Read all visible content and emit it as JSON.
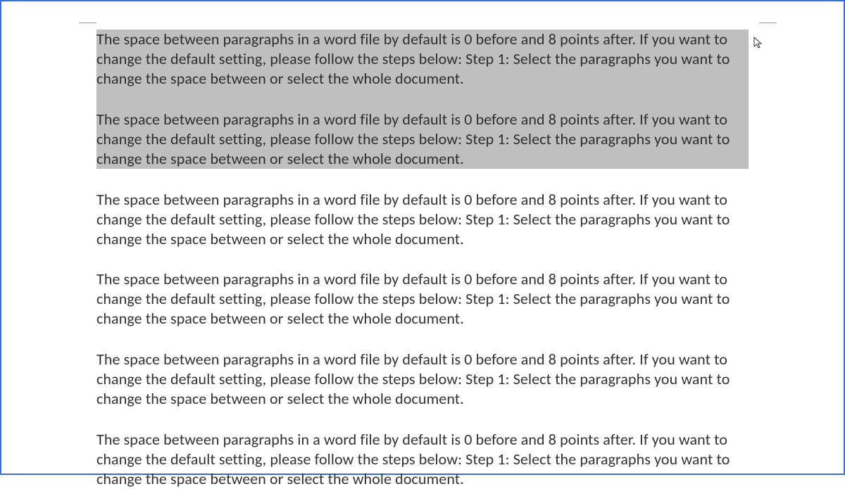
{
  "document": {
    "paragraphs": [
      {
        "text": "The space between paragraphs in a word file by default is 0 before and 8 points after. If you want to change the default setting, please follow the steps below: Step 1: Select the paragraphs you want to change the space between or select the whole document.",
        "selected": true
      },
      {
        "text": "The space between paragraphs in a word file by default is 0 before and 8 points after. If you want to change the default setting, please follow the steps below: Step 1: Select the paragraphs you want to change the space between or select the whole document.",
        "selected": true
      },
      {
        "text": "The space between paragraphs in a word file by default is 0 before and 8 points after. If you want to change the default setting, please follow the steps below: Step 1: Select the paragraphs you want to change the space between or select the whole document.",
        "selected": false
      },
      {
        "text": "The space between paragraphs in a word file by default is 0 before and 8 points after. If you want to change the default setting, please follow the steps below: Step 1: Select the paragraphs you want to change the space between or select the whole document.",
        "selected": false
      },
      {
        "text": "The space between paragraphs in a word file by default is 0 before and 8 points after. If you want to change the default setting, please follow the steps below: Step 1: Select the paragraphs you want to change the space between or select the whole document.",
        "selected": false
      },
      {
        "text": "The space between paragraphs in a word file by default is 0 before and 8 points after. If you want to change the default setting, please follow the steps below: Step 1: Select the paragraphs you want to change the space between or select the whole document.",
        "selected": false
      }
    ]
  }
}
